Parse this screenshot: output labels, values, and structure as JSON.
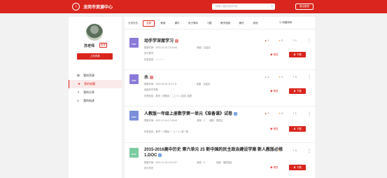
{
  "header": {
    "back_icon": "‹",
    "title": "龙岗市资源中心",
    "search_placeholder": "请输入要查找的内容",
    "search_icon": "⌕",
    "top_button": "退出登录"
  },
  "profile": {
    "name": "苏老师",
    "role": "老师",
    "upload_label": "上传资源"
  },
  "nav": [
    {
      "label": "我的资源",
      "icon": "⊞"
    },
    {
      "label": "我的收藏",
      "icon": "★"
    },
    {
      "label": "我的分享",
      "icon": "⇪"
    },
    {
      "label": "我的轨迹",
      "icon": "≡"
    }
  ],
  "filter": {
    "label": "资源类型：",
    "chips": [
      "全部",
      "教案",
      "课件",
      "电子课本",
      "习题",
      "教学视频",
      "素材",
      "其他"
    ],
    "active_index": 0,
    "sort_label": "⇅ 收藏排序"
  },
  "items": [
    {
      "title": "动手学深度学习",
      "file_type": "PDF",
      "icon_color": "#8b7ad8",
      "badge_color": "#e88a8a",
      "date_label": "更新时间：2022-02-23 13:20:58",
      "area_label": "地图：百金区",
      "owner_label": "初中数学",
      "tag_label": "标签信息：- / - / - / -",
      "likes": "1",
      "stars": "2",
      "shares": "1",
      "preview_label": "◉ 预览",
      "download_label": "⬇ 下载",
      "more": "⋮"
    },
    {
      "title": "水",
      "file_type": "PDF",
      "icon_color": "#8b7ad8",
      "badge_color": "#e88a8a",
      "date_label": "更新时间：2022-02-25 11:47:11",
      "area_label": "地图：百金区",
      "owner_label": "高级初中学教",
      "tag_label": "标签信息：数学 / 苏教版 / 二上 / 1.1 蓝站, 蓝表",
      "likes": "0",
      "stars": "1",
      "shares": "0",
      "preview_label": "◉ 预览",
      "download_label": "⬇ 下载",
      "more": "⋮"
    },
    {
      "title": "人教版一年级上册数学第一单元《准备课》试卷",
      "file_type": "DOC",
      "icon_color": "#7a8fd8",
      "badge_color": "#7aa7e0",
      "date_label": "更新时间：2021-12-16 17:40:43",
      "area_label": "音频：2",
      "owner_label": "地图：德田区",
      "tag_label": "标签信息：数学 / 人教版 / 一上 / 1.1 数一数",
      "likes": "2",
      "stars": "2",
      "shares": "1",
      "preview_label": "◉ 预览",
      "download_label": "⬇ 下载",
      "more": "⋮"
    },
    {
      "title": "2015-2016高中历史 第六单元 25 新中国的民主政治建设学案 新人教版必修1.DOC",
      "file_type": "DOC",
      "icon_color": "#7acba0",
      "badge_color": "#7aa7e0",
      "date_label": "更新时间：2021-12-16 14:14:37",
      "area_label": "音频：5",
      "owner_label": "地图：福田路区",
      "tag_label": "初中历史",
      "likes": "0",
      "stars": "0",
      "shares": "0",
      "preview_label": "◉ 预览",
      "download_label": "⬇ 下载",
      "more": "⋮"
    }
  ]
}
